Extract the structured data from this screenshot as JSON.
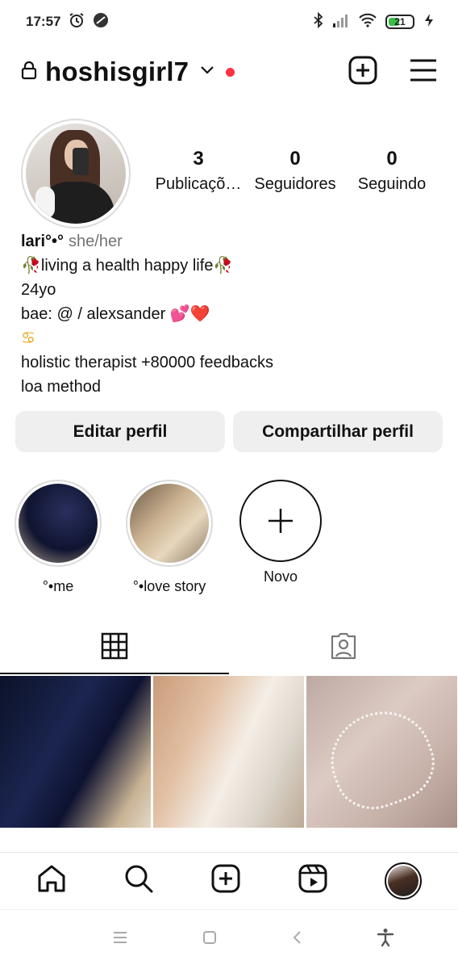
{
  "status_bar": {
    "time": "17:57",
    "battery": "21",
    "icons": [
      "alarm-icon",
      "app-icon",
      "bluetooth-icon",
      "signal-icon",
      "wifi-icon",
      "battery-icon",
      "charging-icon"
    ]
  },
  "header": {
    "username": "hoshisgirl7",
    "icons": [
      "lock-icon",
      "chevron-down-icon",
      "notification-dot",
      "new-post-icon",
      "menu-icon"
    ],
    "dot_color": "#ff3040"
  },
  "stats": [
    {
      "value": "3",
      "label": "Publicaçõ…"
    },
    {
      "value": "0",
      "label": "Seguidores"
    },
    {
      "value": "0",
      "label": "Seguindo"
    }
  ],
  "bio": {
    "name": "lari°•°",
    "pronouns": "she/her",
    "lines": [
      "🥀living a health happy life🥀",
      "24yo",
      "bae: @ / alexsander 💕❤️",
      "♋",
      "holistic therapist +80000 feedbacks",
      "loa method"
    ]
  },
  "buttons": {
    "edit": "Editar perfil",
    "share": "Compartilhar perfil"
  },
  "highlights": [
    {
      "label": "°•me"
    },
    {
      "label": "°•love story"
    },
    {
      "label": "Novo"
    }
  ],
  "tabs": [
    "grid-icon",
    "tagged-icon"
  ],
  "bottom_nav": [
    "home-icon",
    "search-icon",
    "create-icon",
    "reels-icon",
    "profile-avatar"
  ],
  "system_nav": [
    "recents-icon",
    "home-square-icon",
    "back-icon",
    "accessibility-icon"
  ]
}
